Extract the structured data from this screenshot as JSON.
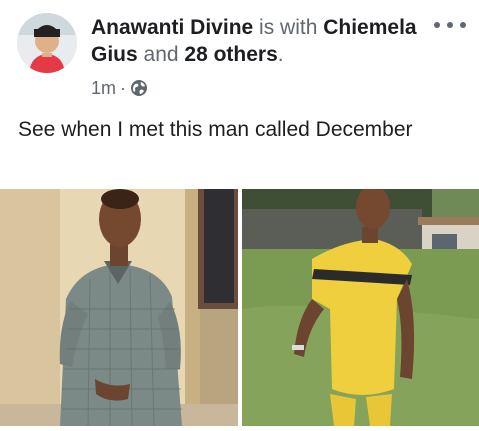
{
  "post": {
    "author": "Anawanti Divine",
    "with_text": " is with ",
    "tagged_person": "Chiemela Gius",
    "and_text": " and ",
    "others": "28 others",
    "period": ".",
    "time": "1m",
    "separator": "·",
    "privacy_icon": "globe-icon",
    "more_icon": "more-options-icon",
    "text": "See when I met this man called December"
  },
  "photos": [
    {
      "description_icon": "photo",
      "index": 1
    },
    {
      "description_icon": "photo",
      "index": 2
    }
  ]
}
